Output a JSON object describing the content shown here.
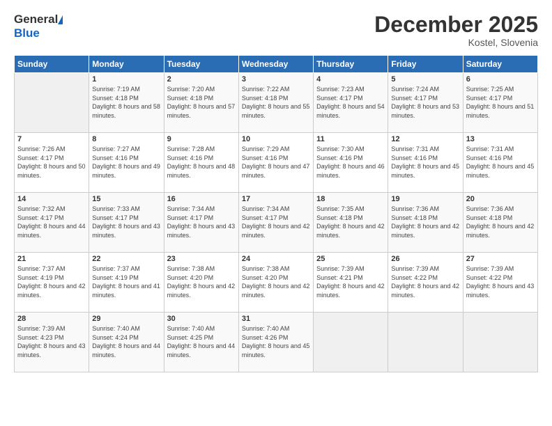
{
  "header": {
    "logo_general": "General",
    "logo_blue": "Blue",
    "month_title": "December 2025",
    "location": "Kostel, Slovenia"
  },
  "days_of_week": [
    "Sunday",
    "Monday",
    "Tuesday",
    "Wednesday",
    "Thursday",
    "Friday",
    "Saturday"
  ],
  "weeks": [
    [
      {
        "day": "",
        "sunrise": "",
        "sunset": "",
        "daylight": ""
      },
      {
        "day": "1",
        "sunrise": "Sunrise: 7:19 AM",
        "sunset": "Sunset: 4:18 PM",
        "daylight": "Daylight: 8 hours and 58 minutes."
      },
      {
        "day": "2",
        "sunrise": "Sunrise: 7:20 AM",
        "sunset": "Sunset: 4:18 PM",
        "daylight": "Daylight: 8 hours and 57 minutes."
      },
      {
        "day": "3",
        "sunrise": "Sunrise: 7:22 AM",
        "sunset": "Sunset: 4:18 PM",
        "daylight": "Daylight: 8 hours and 55 minutes."
      },
      {
        "day": "4",
        "sunrise": "Sunrise: 7:23 AM",
        "sunset": "Sunset: 4:17 PM",
        "daylight": "Daylight: 8 hours and 54 minutes."
      },
      {
        "day": "5",
        "sunrise": "Sunrise: 7:24 AM",
        "sunset": "Sunset: 4:17 PM",
        "daylight": "Daylight: 8 hours and 53 minutes."
      },
      {
        "day": "6",
        "sunrise": "Sunrise: 7:25 AM",
        "sunset": "Sunset: 4:17 PM",
        "daylight": "Daylight: 8 hours and 51 minutes."
      }
    ],
    [
      {
        "day": "7",
        "sunrise": "Sunrise: 7:26 AM",
        "sunset": "Sunset: 4:17 PM",
        "daylight": "Daylight: 8 hours and 50 minutes."
      },
      {
        "day": "8",
        "sunrise": "Sunrise: 7:27 AM",
        "sunset": "Sunset: 4:16 PM",
        "daylight": "Daylight: 8 hours and 49 minutes."
      },
      {
        "day": "9",
        "sunrise": "Sunrise: 7:28 AM",
        "sunset": "Sunset: 4:16 PM",
        "daylight": "Daylight: 8 hours and 48 minutes."
      },
      {
        "day": "10",
        "sunrise": "Sunrise: 7:29 AM",
        "sunset": "Sunset: 4:16 PM",
        "daylight": "Daylight: 8 hours and 47 minutes."
      },
      {
        "day": "11",
        "sunrise": "Sunrise: 7:30 AM",
        "sunset": "Sunset: 4:16 PM",
        "daylight": "Daylight: 8 hours and 46 minutes."
      },
      {
        "day": "12",
        "sunrise": "Sunrise: 7:31 AM",
        "sunset": "Sunset: 4:16 PM",
        "daylight": "Daylight: 8 hours and 45 minutes."
      },
      {
        "day": "13",
        "sunrise": "Sunrise: 7:31 AM",
        "sunset": "Sunset: 4:16 PM",
        "daylight": "Daylight: 8 hours and 45 minutes."
      }
    ],
    [
      {
        "day": "14",
        "sunrise": "Sunrise: 7:32 AM",
        "sunset": "Sunset: 4:17 PM",
        "daylight": "Daylight: 8 hours and 44 minutes."
      },
      {
        "day": "15",
        "sunrise": "Sunrise: 7:33 AM",
        "sunset": "Sunset: 4:17 PM",
        "daylight": "Daylight: 8 hours and 43 minutes."
      },
      {
        "day": "16",
        "sunrise": "Sunrise: 7:34 AM",
        "sunset": "Sunset: 4:17 PM",
        "daylight": "Daylight: 8 hours and 43 minutes."
      },
      {
        "day": "17",
        "sunrise": "Sunrise: 7:34 AM",
        "sunset": "Sunset: 4:17 PM",
        "daylight": "Daylight: 8 hours and 42 minutes."
      },
      {
        "day": "18",
        "sunrise": "Sunrise: 7:35 AM",
        "sunset": "Sunset: 4:18 PM",
        "daylight": "Daylight: 8 hours and 42 minutes."
      },
      {
        "day": "19",
        "sunrise": "Sunrise: 7:36 AM",
        "sunset": "Sunset: 4:18 PM",
        "daylight": "Daylight: 8 hours and 42 minutes."
      },
      {
        "day": "20",
        "sunrise": "Sunrise: 7:36 AM",
        "sunset": "Sunset: 4:18 PM",
        "daylight": "Daylight: 8 hours and 42 minutes."
      }
    ],
    [
      {
        "day": "21",
        "sunrise": "Sunrise: 7:37 AM",
        "sunset": "Sunset: 4:19 PM",
        "daylight": "Daylight: 8 hours and 42 minutes."
      },
      {
        "day": "22",
        "sunrise": "Sunrise: 7:37 AM",
        "sunset": "Sunset: 4:19 PM",
        "daylight": "Daylight: 8 hours and 41 minutes."
      },
      {
        "day": "23",
        "sunrise": "Sunrise: 7:38 AM",
        "sunset": "Sunset: 4:20 PM",
        "daylight": "Daylight: 8 hours and 42 minutes."
      },
      {
        "day": "24",
        "sunrise": "Sunrise: 7:38 AM",
        "sunset": "Sunset: 4:20 PM",
        "daylight": "Daylight: 8 hours and 42 minutes."
      },
      {
        "day": "25",
        "sunrise": "Sunrise: 7:39 AM",
        "sunset": "Sunset: 4:21 PM",
        "daylight": "Daylight: 8 hours and 42 minutes."
      },
      {
        "day": "26",
        "sunrise": "Sunrise: 7:39 AM",
        "sunset": "Sunset: 4:22 PM",
        "daylight": "Daylight: 8 hours and 42 minutes."
      },
      {
        "day": "27",
        "sunrise": "Sunrise: 7:39 AM",
        "sunset": "Sunset: 4:22 PM",
        "daylight": "Daylight: 8 hours and 43 minutes."
      }
    ],
    [
      {
        "day": "28",
        "sunrise": "Sunrise: 7:39 AM",
        "sunset": "Sunset: 4:23 PM",
        "daylight": "Daylight: 8 hours and 43 minutes."
      },
      {
        "day": "29",
        "sunrise": "Sunrise: 7:40 AM",
        "sunset": "Sunset: 4:24 PM",
        "daylight": "Daylight: 8 hours and 44 minutes."
      },
      {
        "day": "30",
        "sunrise": "Sunrise: 7:40 AM",
        "sunset": "Sunset: 4:25 PM",
        "daylight": "Daylight: 8 hours and 44 minutes."
      },
      {
        "day": "31",
        "sunrise": "Sunrise: 7:40 AM",
        "sunset": "Sunset: 4:26 PM",
        "daylight": "Daylight: 8 hours and 45 minutes."
      },
      {
        "day": "",
        "sunrise": "",
        "sunset": "",
        "daylight": ""
      },
      {
        "day": "",
        "sunrise": "",
        "sunset": "",
        "daylight": ""
      },
      {
        "day": "",
        "sunrise": "",
        "sunset": "",
        "daylight": ""
      }
    ]
  ]
}
